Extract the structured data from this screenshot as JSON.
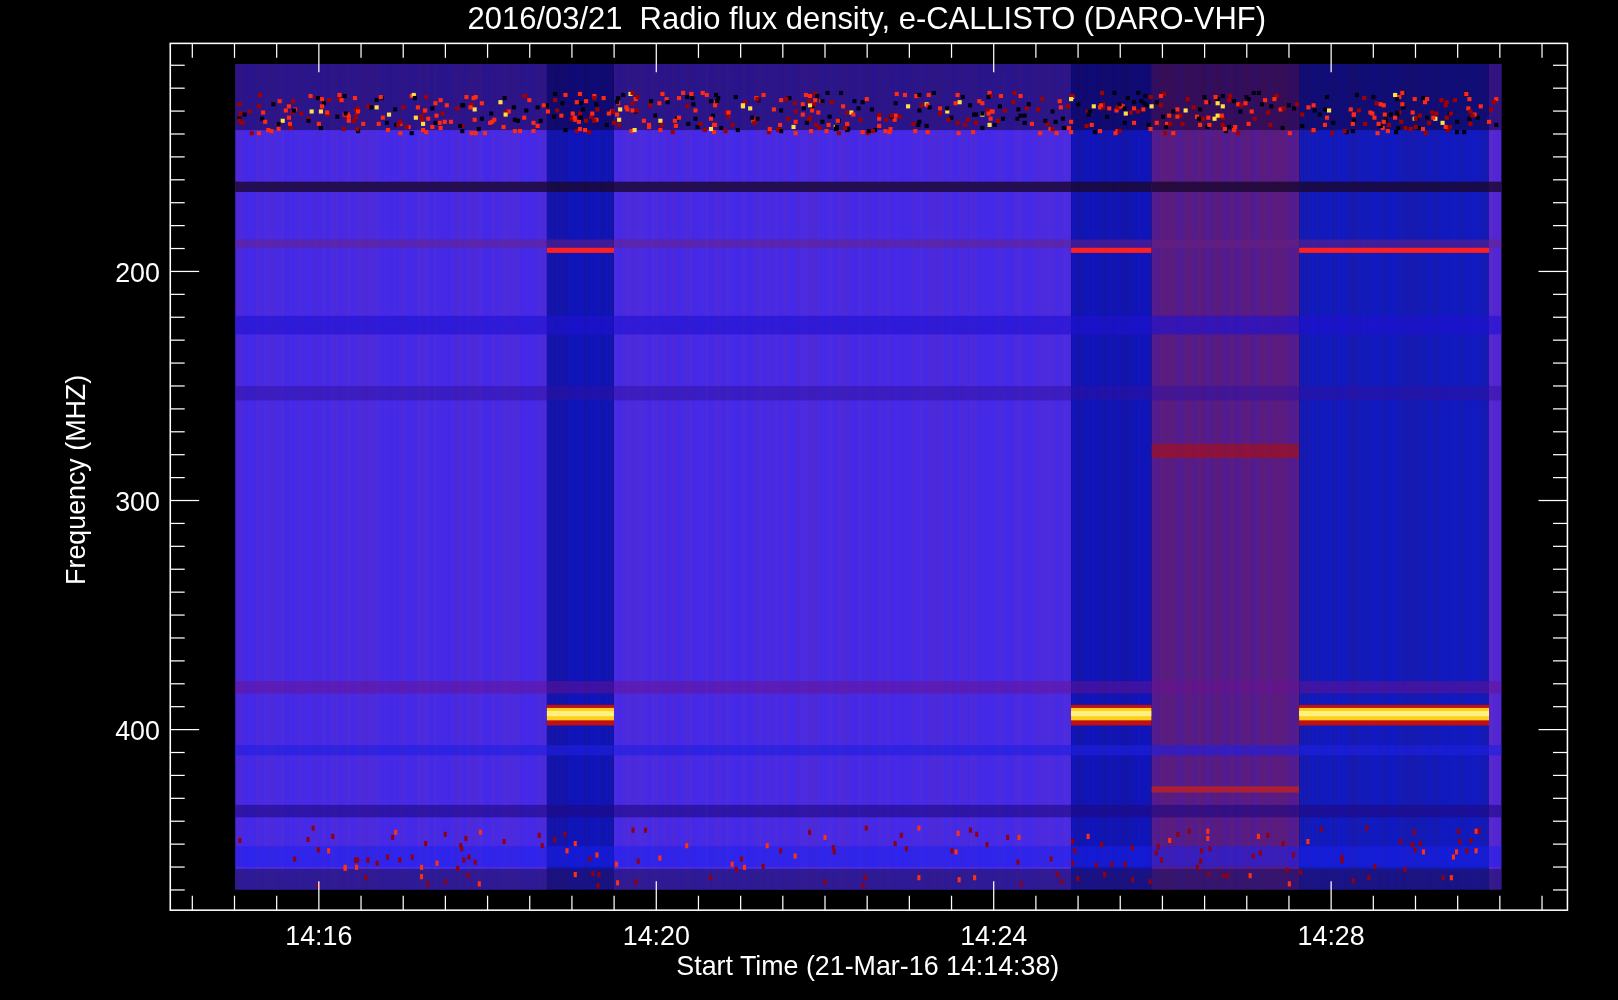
{
  "title": "2016/03/21  Radio flux density, e-CALLISTO (DARO-VHF)",
  "y_axis": {
    "label": "Frequency (MHZ)",
    "ticks": [
      "200",
      "300",
      "400"
    ]
  },
  "x_axis": {
    "label": "Start Time (21-Mar-16 14:14:38)",
    "ticks": [
      "14:16",
      "14:20",
      "14:24",
      "14:28"
    ]
  }
}
